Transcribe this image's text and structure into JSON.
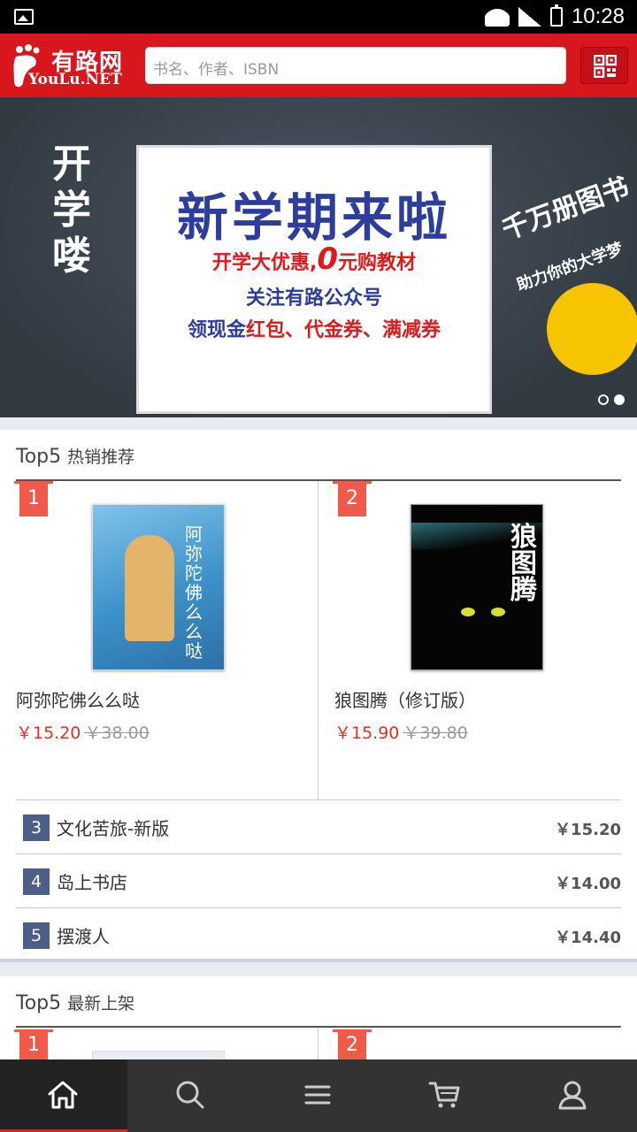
{
  "status_bar": {
    "time": "10:28"
  },
  "header": {
    "logo_cn": "有路网",
    "logo_en": "YouLu.NET",
    "search_placeholder": "书名、作者、ISBN"
  },
  "banner": {
    "left_text": "开学喽",
    "headline": "新学期来啦",
    "line2_a": "开学大优惠,",
    "line2_b": "0",
    "line2_c": "元购教材",
    "line3": "关注有路公众号",
    "line4_a": "领现金",
    "line4_b": "红包、代金券、满减券",
    "right_text1": "千万册图书",
    "right_text2": "助力你的大学梦",
    "slide_count": 2,
    "active_slide": 2
  },
  "section_hot": {
    "title": "Top5",
    "subtitle": "热销推荐",
    "top_items": [
      {
        "rank": "1",
        "name": "阿弥陀佛么么哒",
        "price": "￥15.20",
        "old_price": "￥38.00",
        "cover_title": "阿弥陀佛么么哒"
      },
      {
        "rank": "2",
        "name": "狼图腾（修订版）",
        "price": "￥15.90",
        "old_price": "￥39.80",
        "cover_title": "狼图腾"
      }
    ],
    "list_items": [
      {
        "rank": "3",
        "name": "文化苦旅-新版",
        "price": "￥15.20"
      },
      {
        "rank": "4",
        "name": "岛上书店",
        "price": "￥14.00"
      },
      {
        "rank": "5",
        "name": "摆渡人",
        "price": "￥14.40"
      }
    ]
  },
  "section_new": {
    "title": "Top5",
    "subtitle": "最新上架",
    "ranks": [
      "1",
      "2"
    ]
  },
  "tabbar": [
    "home-icon",
    "search-icon",
    "menu-icon",
    "cart-icon",
    "user-icon"
  ],
  "colors": {
    "brand_red": "#d8161e",
    "price_red": "#e0331f",
    "rank_tag": "#f05a4b",
    "rank_num": "#4e5f87"
  }
}
